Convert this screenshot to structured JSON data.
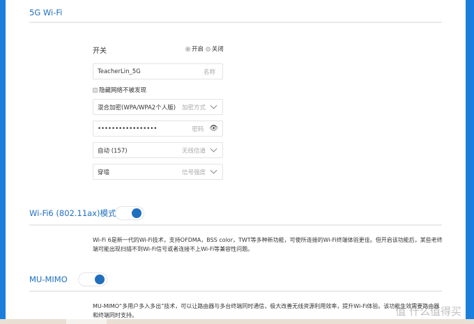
{
  "section_5g": {
    "title": "5G Wi-Fi"
  },
  "switch": {
    "label": "开关",
    "on_label": "开启",
    "off_label": "关闭",
    "selected": "开启"
  },
  "ssid": {
    "value": "TeacherLin_5G",
    "label": "名称"
  },
  "hide": {
    "label": "隐藏网络不被发现",
    "checked": false
  },
  "encryption": {
    "value": "混合加密(WPA/WPA2个人版)",
    "label": "加密方式"
  },
  "password": {
    "value": "•••••••••••••••••",
    "label": "密码"
  },
  "channel": {
    "value": "自动 (157)",
    "label": "无线信道"
  },
  "power": {
    "value": "穿墙",
    "label": "信号强度"
  },
  "wifi6": {
    "title": "Wi-Fi6 (802.11ax)模式",
    "enabled": true,
    "desc": "Wi-Fi 6是新一代的Wi-Fi技术，支持OFDMA，BSS color，TWT等多种新功能，可使所连接的Wi-Fi终端体验更佳。但开启该功能后，某些老终端可能出现扫描不到Wi-Fi信号或者连接不上Wi-Fi等兼容性问题。"
  },
  "mumimo": {
    "title": "MU-MIMO",
    "enabled": true,
    "desc": "MU-MIMO“多用户多入多出”技术，可以让路由器与多台终端同时通信，极大改善无线资源利用效率，提升Wi-Fi体验。该功能生效需要路由器和终端同时支持。"
  },
  "watermark": "值 什么值得买"
}
